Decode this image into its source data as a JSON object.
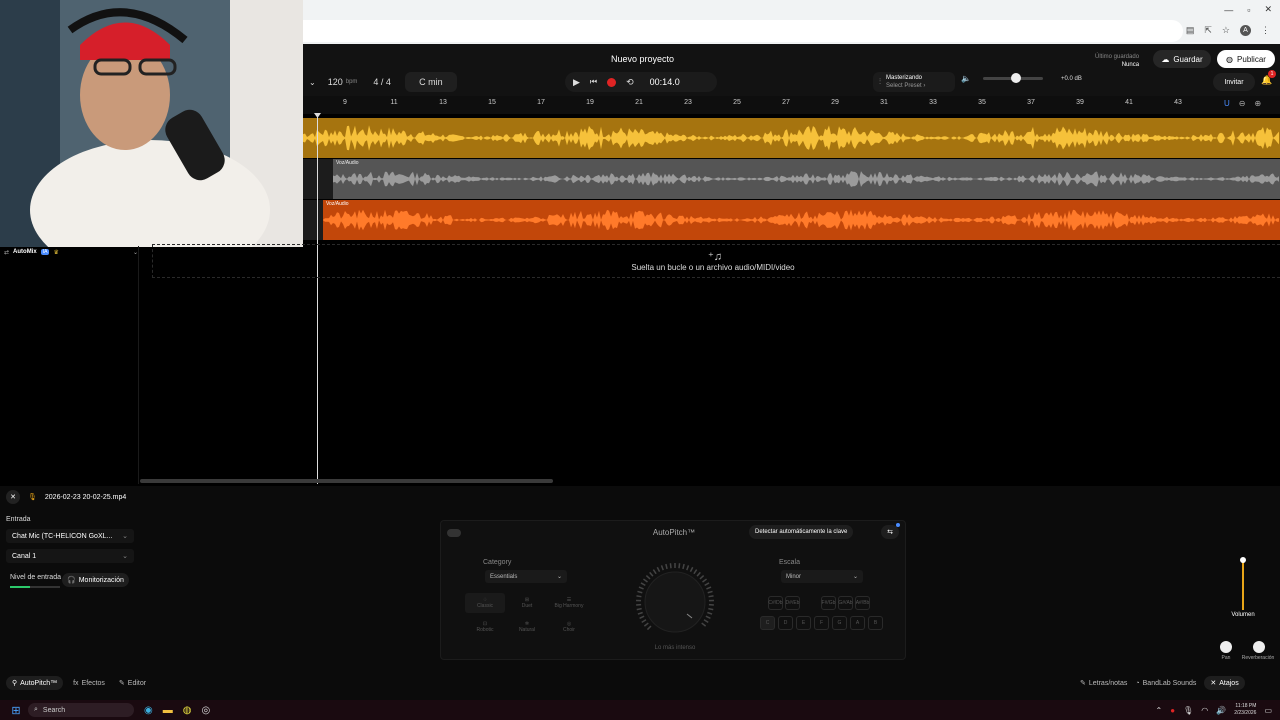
{
  "project_title": "Nuevo proyecto",
  "header": {
    "bpm": "120",
    "bpm_unit": "bpm",
    "time_signature": "4 / 4",
    "key": "C min",
    "time_display": "00:14.0",
    "mastering_label": "Masterizando",
    "preset_label": "Select Preset ›",
    "volume_db": "+0.0 dB",
    "last_saved_label": "Último guardado",
    "last_saved_value": "Nunca",
    "save_label": "Guardar",
    "publish_label": "Publicar",
    "invite_label": "Invitar",
    "notification_count": "1"
  },
  "ruler_ticks": [
    "9",
    "11",
    "13",
    "15",
    "17",
    "19",
    "21",
    "23",
    "25",
    "27",
    "29",
    "31",
    "33",
    "35",
    "37",
    "39",
    "41",
    "43"
  ],
  "tracks": [
    {
      "label": "",
      "color": "#e8a518"
    },
    {
      "label": "Voz/Audio",
      "color": "#8a8a8a"
    },
    {
      "label": "Voz/Audio",
      "color": "#ff6a13"
    }
  ],
  "automix": {
    "label": "AutoMix",
    "badge": "IA"
  },
  "drop_zone_text": "Suelta un bucle o un archivo audio/MIDI/video",
  "bottom_panel": {
    "file_name": "2026-02-23 20-02-25.mp4",
    "input_label": "Entrada",
    "input_device": "Chat Mic (TC-HELICON GoXL...",
    "channel": "Canal 1",
    "input_level_label": "Nivel de entrada",
    "monitoring_label": "Monitorización",
    "autopitch_title": "AutoPitch™",
    "detect_key_label": "Detectar automáticamente la clave",
    "category_label": "Category",
    "category_value": "Essentials",
    "scale_label": "Escala",
    "scale_value": "Minor",
    "presets": [
      "Classic",
      "Duet",
      "Big Harmony",
      "Robotic",
      "Natural",
      "Choir"
    ],
    "knob_label": "Lo más intenso",
    "notes_row1": [
      "C#/Db",
      "D#/Eb",
      "F#/Gb",
      "G#/Ab",
      "A#/Bb"
    ],
    "notes_row2": [
      "C",
      "D",
      "E",
      "F",
      "G",
      "A",
      "B"
    ],
    "volume_label": "Volumen",
    "pan_label": "Pan",
    "reverb_label": "Reverberación"
  },
  "bottom_tabs": {
    "autopitch": "AutoPitch™",
    "effects": "Efectos",
    "editor": "Editor",
    "lyrics": "Letras/notas",
    "sounds": "BandLab Sounds",
    "shortcuts": "Atajos"
  },
  "taskbar": {
    "search_placeholder": "Search",
    "time": "11:18 PM",
    "date": "2/23/2026"
  },
  "colors": {
    "accent_blue": "#4a8cff",
    "record_red": "#e02424",
    "track_yellow": "#e8a518",
    "track_orange": "#ff6a13",
    "level_green": "#2cc96a",
    "volume_orange": "#e8a518"
  }
}
